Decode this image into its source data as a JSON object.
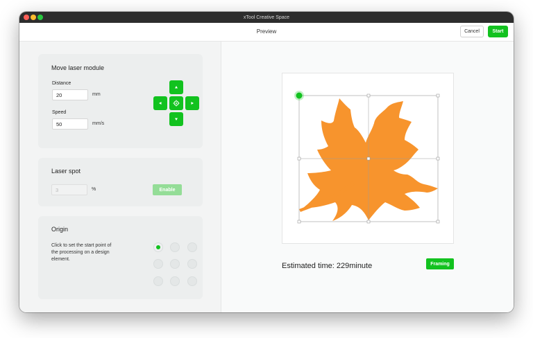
{
  "window": {
    "title": "xTool Creative Space"
  },
  "header": {
    "title": "Preview",
    "cancel_label": "Cancel",
    "start_label": "Start"
  },
  "move_module": {
    "title": "Move laser module",
    "distance_label": "Distance",
    "distance_value": "20",
    "distance_unit": "mm",
    "speed_label": "Speed",
    "speed_value": "50",
    "speed_unit": "mm/s"
  },
  "laser_spot": {
    "title": "Laser spot",
    "value": "3",
    "unit": "%",
    "enable_label": "Enable"
  },
  "origin": {
    "title": "Origin",
    "description": "Click to set the start point of the processing on a design element.",
    "selected": "top-left"
  },
  "preview": {
    "estimated_time": "Estimated time: 229minute",
    "framing_label": "Framing"
  },
  "colors": {
    "accent": "#12c21f",
    "leaf": "#f7942d",
    "accent_disabled": "#94dd97"
  }
}
